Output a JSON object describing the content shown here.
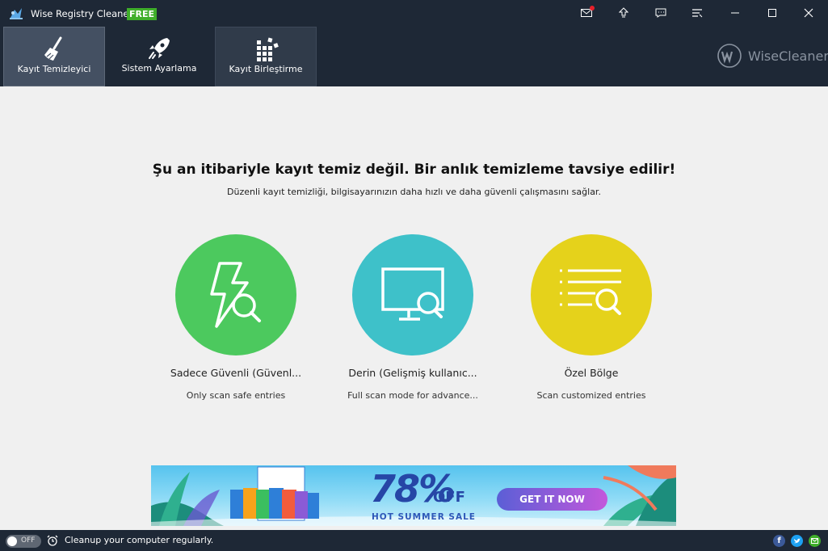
{
  "window": {
    "title": "Wise Registry Cleaner X",
    "badge": "FREE",
    "buttons": [
      "mail-icon",
      "upgrade-icon",
      "feedback-icon",
      "menu-icon",
      "minimize-icon",
      "maximize-icon",
      "close-icon"
    ]
  },
  "tabs": [
    {
      "label": "Kayıt Temizleyici",
      "icon": "broom-icon",
      "active": true
    },
    {
      "label": "Sistem Ayarlama",
      "icon": "rocket-icon",
      "active": false
    },
    {
      "label": "Kayıt Birleştirme",
      "icon": "blocks-icon",
      "active": false
    }
  ],
  "brand": {
    "name": "WiseCleaner"
  },
  "main": {
    "headline": "Şu an itibariyle kayıt temiz değil. Bir anlık temizleme tavsiye edilir!",
    "subline": "Düzenli kayıt temizliği, bilgisayarınızın daha hızlı ve daha güvenli çalışmasını sağlar.",
    "modes": [
      {
        "title": "Sadece Güvenli (Güvenl...",
        "desc": "Only scan safe entries",
        "color": "#4cc95e",
        "icon": "lightning-search-icon"
      },
      {
        "title": "Derin (Gelişmiş kullanıc...",
        "desc": "Full scan mode for advance...",
        "color": "#3ec1c9",
        "icon": "monitor-search-icon"
      },
      {
        "title": "Özel Bölge",
        "desc": "Scan customized entries",
        "color": "#e5d21b",
        "icon": "list-search-icon"
      }
    ]
  },
  "banner": {
    "discount": "78%",
    "off": "OFF",
    "sale": "HOT SUMMER SALE",
    "button": "GET IT NOW"
  },
  "status": {
    "toggle": "OFF",
    "text": "Cleanup your computer regularly."
  },
  "social": [
    "facebook-icon",
    "twitter-icon",
    "email-icon"
  ]
}
